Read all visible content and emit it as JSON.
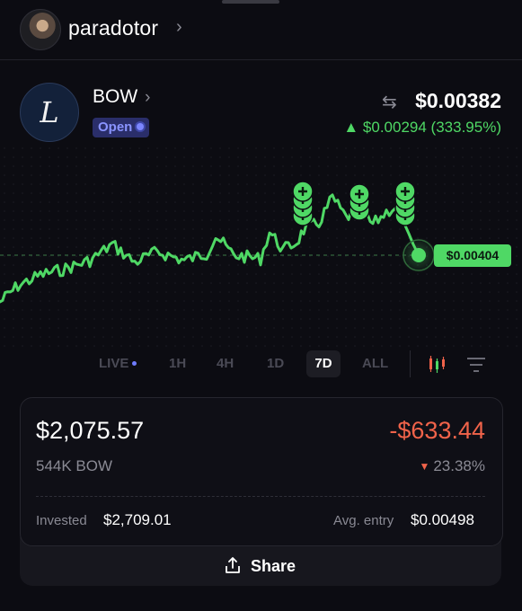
{
  "header": {
    "username": "paradotor",
    "chevron": "›"
  },
  "coin": {
    "symbol": "BOW",
    "logo_glyph": "L",
    "status": "Open",
    "price": "$0.00382",
    "change": "▲ $0.00294 (333.95%)",
    "change_color": "#4fd865"
  },
  "chart": {
    "current_label": "$0.00404",
    "line_color": "#4fd865",
    "buy_markers": 10
  },
  "timeframes": {
    "live": "LIVE",
    "h1": "1H",
    "h4": "4H",
    "d1": "1D",
    "d7": "7D",
    "all": "ALL",
    "selected": "7D"
  },
  "position": {
    "value": "$2,075.57",
    "pnl": "-$633.44",
    "pnl_color": "#f0634a",
    "quantity": "544K BOW",
    "pnl_pct": "23.38%",
    "invested_label": "Invested",
    "invested": "$2,709.01",
    "avg_entry_label": "Avg. entry",
    "avg_entry": "$0.00498"
  },
  "share": {
    "label": "Share"
  }
}
